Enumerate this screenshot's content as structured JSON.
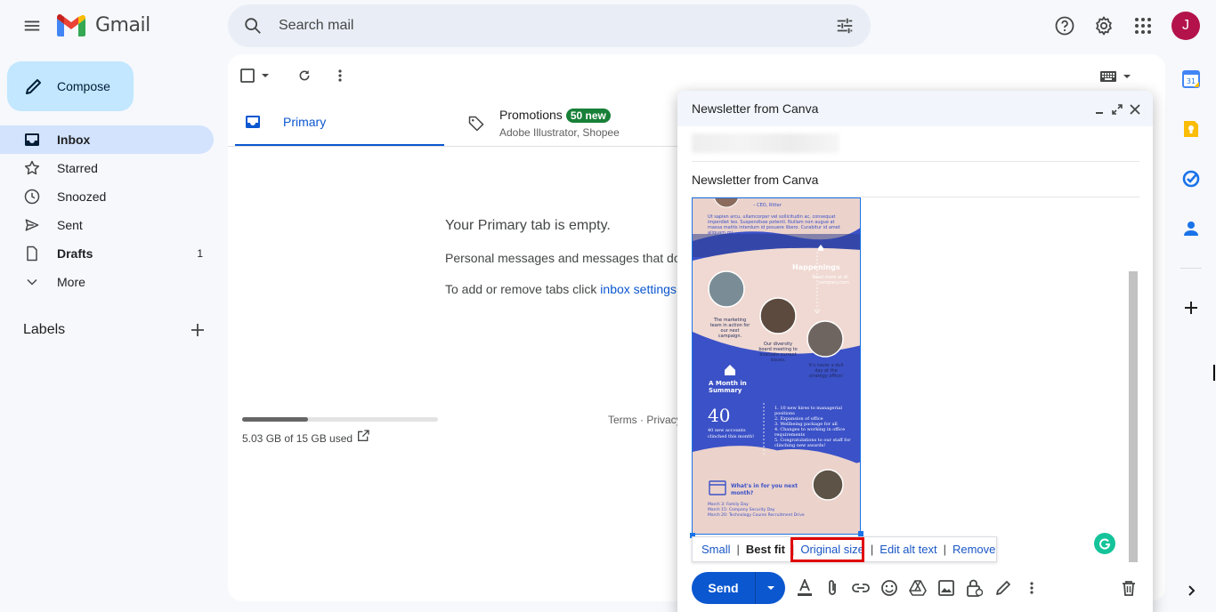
{
  "app": {
    "brand": "Gmail",
    "avatar_initial": "J",
    "avatar_color": "#b3124a"
  },
  "search": {
    "placeholder": "Search mail"
  },
  "sidebar": {
    "compose_label": "Compose",
    "items": [
      {
        "label": "Inbox",
        "count": "",
        "active": true
      },
      {
        "label": "Starred",
        "count": ""
      },
      {
        "label": "Snoozed",
        "count": ""
      },
      {
        "label": "Sent",
        "count": ""
      },
      {
        "label": "Drafts",
        "count": "1"
      },
      {
        "label": "More",
        "count": ""
      }
    ],
    "labels_title": "Labels"
  },
  "tabs": {
    "primary": "Primary",
    "promotions": {
      "label": "Promotions",
      "badge": "50 new",
      "subtitle": "Adobe Illustrator, Shopee"
    }
  },
  "empty_state": {
    "title": "Your Primary tab is empty.",
    "line1": "Personal messages and messages that do",
    "line2_prefix": "To add or remove tabs click ",
    "line2_link": "inbox settings"
  },
  "storage": {
    "text": "5.03 GB of 15 GB used",
    "used_fraction": 0.335
  },
  "footer": {
    "links": "Terms · Privacy"
  },
  "compose_window": {
    "title": "Newsletter from Canva",
    "subject": "Newsletter from Canva",
    "send_label": "Send"
  },
  "newsletter": {
    "quote_attr": "– CEO, Ritter",
    "intro": "Ut sapien arcu, ullamcorper vel sollicitudin ac, consequat imperdiet leo. Suspendisse potenti. Nullam non augue at massa mattis interdum id posuere libero. Curabitur id amet aliquam mi.",
    "happenings": "Happenings",
    "happenings_sub": "Read more at dl-company.com",
    "cap1": "The marketing team in action for our next campaign.",
    "cap2": "Our diversity board meeting to evaluate current issues.",
    "cap3": "It's never a dull day at the strategy office!",
    "summary": "A Month in Summary",
    "big_number": "40",
    "big_caption": "40 new accounts clinched this month!",
    "list": [
      "1. 10 new hires to managerial positions",
      "2. Expansion of office",
      "3. Wellbeing package for all",
      "4. Changes to working in office requirements",
      "5. Congratulations to our staff for clinching new awards!"
    ],
    "next_month": "What's in for you next month?",
    "events": [
      "March 3: Family Day",
      "March 15: Company Security Day",
      "March 20: Technology Course Recruitment Drive"
    ]
  },
  "image_toolbar": {
    "small": "Small",
    "best_fit": "Best fit",
    "original": "Original size",
    "alt": "Edit alt text",
    "remove": "Remove"
  }
}
